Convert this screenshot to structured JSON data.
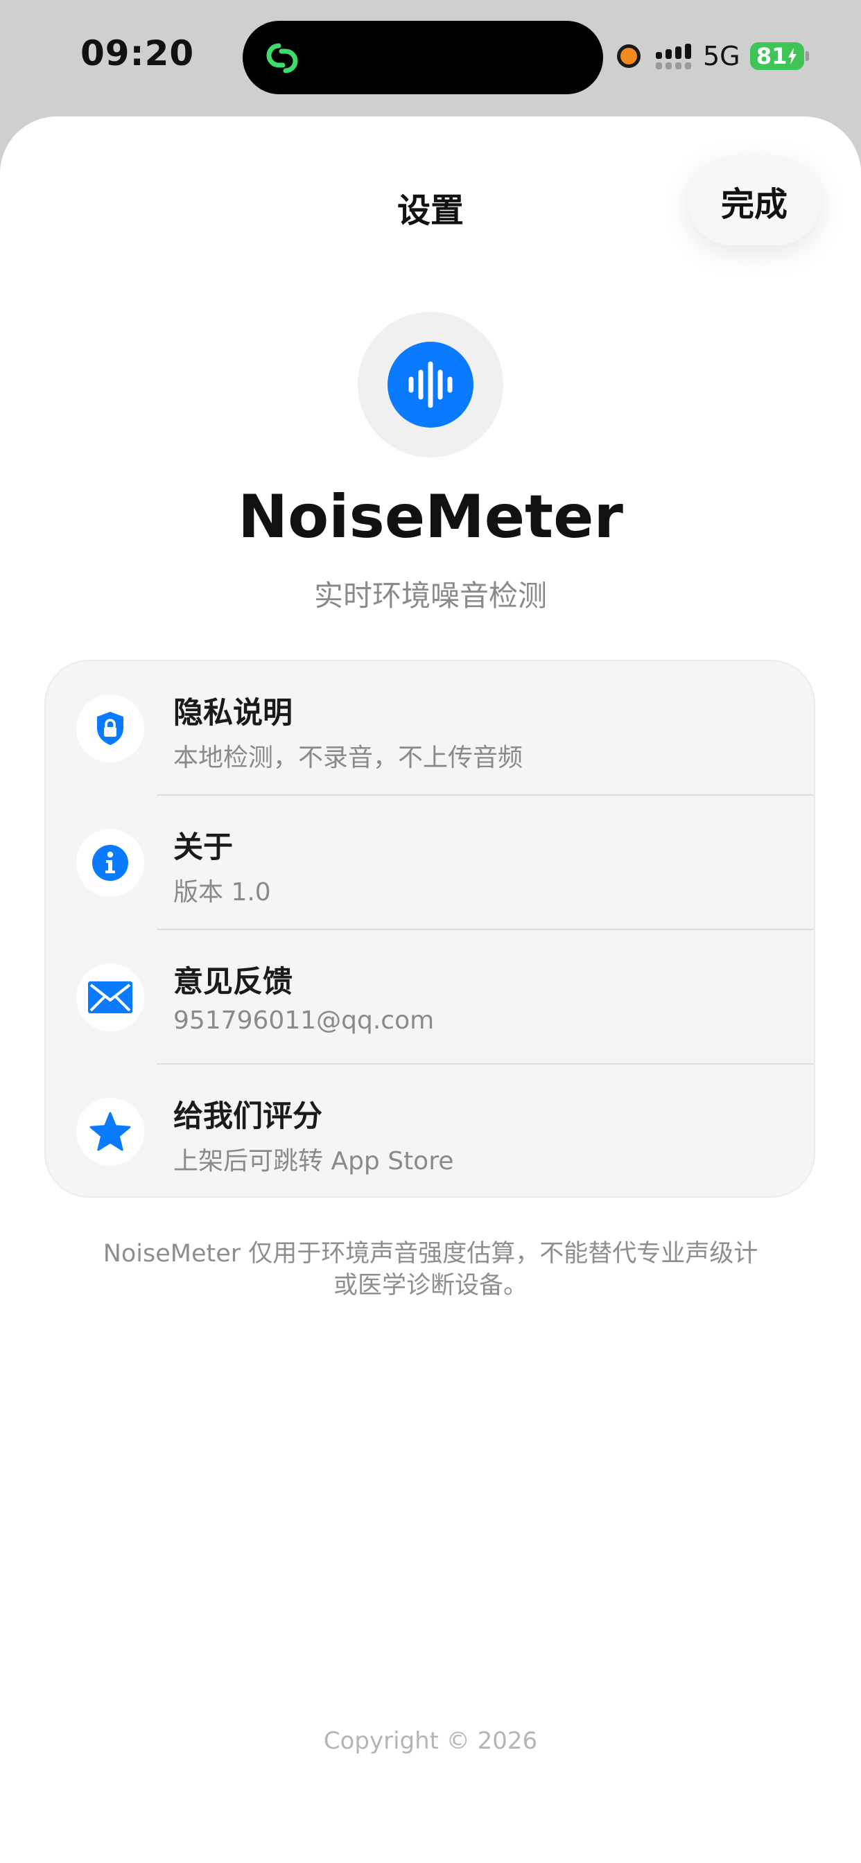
{
  "status_bar": {
    "time": "09:20",
    "network": "5G",
    "battery": "81",
    "island_app_icon": "link-rings-icon",
    "colors": {
      "island_icon": "#3ddc6b",
      "mic_indicator": "#f58a1f",
      "battery": "#3ec457"
    }
  },
  "nav": {
    "title": "设置",
    "done_label": "完成"
  },
  "app": {
    "icon": "waveform-icon",
    "name": "NoiseMeter",
    "subtitle": "实时环境噪音检测",
    "accent_color": "#0a7aff"
  },
  "settings": {
    "items": [
      {
        "icon": "shield-lock-icon",
        "title": "隐私说明",
        "subtitle": "本地检测，不录音，不上传音频"
      },
      {
        "icon": "info-icon",
        "title": "关于",
        "subtitle": "版本 1.0"
      },
      {
        "icon": "envelope-icon",
        "title": "意见反馈",
        "subtitle": "951796011@qq.com"
      },
      {
        "icon": "star-icon",
        "title": "给我们评分",
        "subtitle": "上架后可跳转 App Store"
      }
    ]
  },
  "disclaimer": {
    "line1": "NoiseMeter 仅用于环境声音强度估算，不能替代专业声级计",
    "line2": "或医学诊断设备。"
  },
  "footer": {
    "copyright": "Copyright © 2026"
  }
}
